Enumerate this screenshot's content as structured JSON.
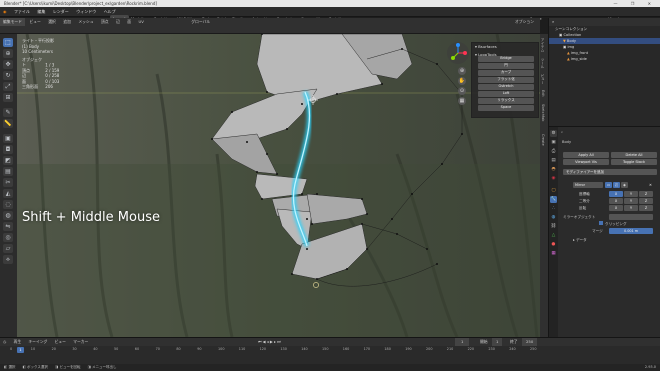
{
  "window_title": "Blender* [C:\\Users\\ikumi\\Desktop\\Blender\\project_ex\\garden\\Rockrim.blend]",
  "window_controls": "— ❐ ✕",
  "menu": {
    "file": "ファイル",
    "edit": "編集",
    "render": "レンダー",
    "window": "ウィンドウ",
    "help": "ヘルプ"
  },
  "workspaces": {
    "layout": "Layout",
    "modeling": "Modeling",
    "sculpting": "Sculpting",
    "uv_editing": "UV Editing",
    "texture_paint": "Texture Paint",
    "shading": "Shading",
    "animation": "Animation",
    "rendering": "Rendering",
    "compositing": "Compositing",
    "scripting": "Scripting"
  },
  "scene_label": "Scene",
  "view_layer_label": "View Layer",
  "viewport_header": {
    "mode": "編集モード",
    "view": "ビュー",
    "select": "選択",
    "add": "追加",
    "mesh": "メッシュ",
    "vertex": "頂点",
    "edge": "辺",
    "face": "面",
    "uv": "UV",
    "orientation": "グローバル",
    "options": "オプション"
  },
  "stats": {
    "line1": "ライト・平行投影",
    "line2": "(1) Body",
    "line3": "10 Centimeters",
    "objects_label": "オブジェクト",
    "objects_value": "1 / 3",
    "vertices_label": "頂点",
    "vertices_value": "2 / 159",
    "edges_label": "辺",
    "edges_value": "0 / 258",
    "faces_label": "面",
    "faces_value": "0 / 103",
    "tris_label": "三角形面",
    "tris_value": "206"
  },
  "overlay_text": "Shift + Middle Mouse",
  "looptools": {
    "header1": "▾ Bsurfaces",
    "header2": "▾ LoopTools",
    "buttons": [
      "Bridge",
      "円",
      "カーブ",
      "フラット化",
      "Gstretch",
      "Loft",
      "リラックス",
      "Space"
    ]
  },
  "side_tabs": [
    "アイテム",
    "ツール",
    "ビュー",
    "Edit",
    "Sketchfab",
    "Create"
  ],
  "outliner": {
    "header": "シーンコレクション",
    "rows": [
      "Collection",
      "Body",
      "img",
      "img_front",
      "img_side"
    ]
  },
  "properties": {
    "object_name": "Body",
    "apply": "Apply All",
    "delete": "Delete All",
    "viewport_vis": "Viewport Vis",
    "toggle_stack": "Toggle Stack",
    "add_modifier": "モディファイアーを追加",
    "modifier_name": "Mirror",
    "axis_label": "座標軸",
    "bisect_label": "二等分",
    "flip_label": "反転",
    "x": "X",
    "y": "Y",
    "z": "Z",
    "mirror_object": "ミラーオブジェクト",
    "clipping": "クリッピング",
    "merge": "マージ",
    "merge_value": "0.001 m",
    "data": "▸ データ"
  },
  "timeline": {
    "playback": "再生",
    "keying": "キーイング",
    "view": "ビュー",
    "marker": "マーカー",
    "frame_current": "1",
    "start_label": "開始",
    "start": "1",
    "end_label": "終了",
    "end": "250",
    "ticks": [
      "0",
      "10",
      "20",
      "30",
      "40",
      "50",
      "60",
      "70",
      "80",
      "90",
      "100",
      "110",
      "120",
      "130",
      "140",
      "150",
      "160",
      "170",
      "180",
      "190",
      "200",
      "210",
      "220",
      "230",
      "240",
      "250"
    ]
  },
  "statusbar": {
    "select": "選択",
    "box_select": "ボックス選択",
    "rotate_view": "ビューを回転",
    "menu": "メニュー呼出し",
    "version": "2.93.0"
  },
  "colors": {
    "accent": "#4772b3",
    "highlight_curve": "#27d4ff",
    "mesh_fill": "#b9b9b9",
    "viewport_bg": "#4a4e45"
  }
}
